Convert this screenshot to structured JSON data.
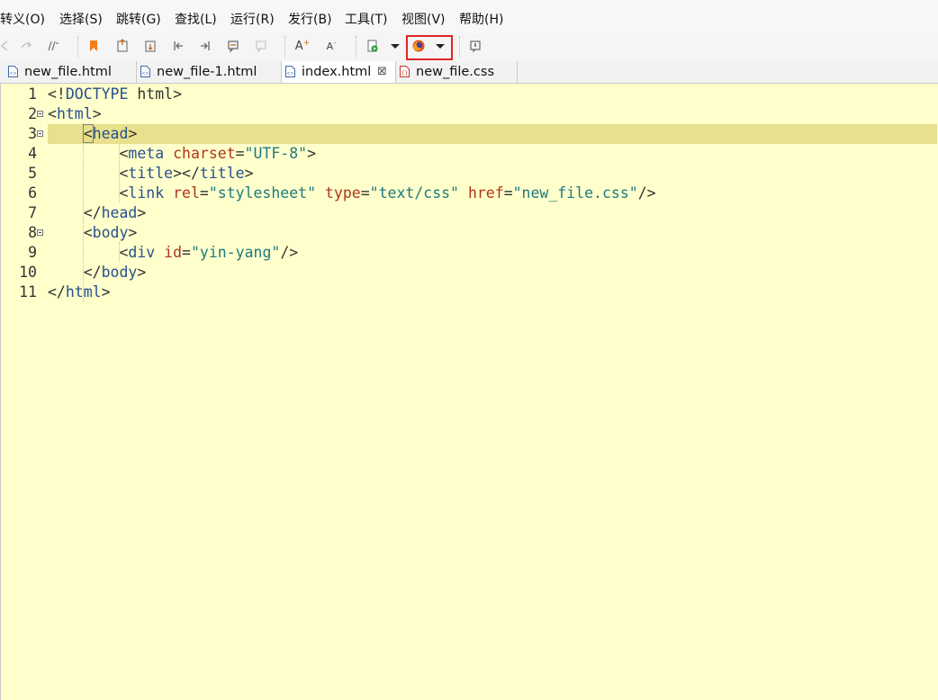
{
  "menu": {
    "items": [
      "转义(O)",
      "选择(S)",
      "跳转(G)",
      "查找(L)",
      "运行(R)",
      "发行(B)",
      "工具(T)",
      "视图(V)",
      "帮助(H)"
    ]
  },
  "toolbar": {
    "icons": [
      "back-icon",
      "forward-icon",
      "format-icon",
      "bookmark-icon",
      "bookmark-prev-icon",
      "bookmark-next-icon",
      "goto-start-icon",
      "goto-end-icon",
      "comment-icon",
      "uncomment-icon",
      "font-increase-icon",
      "font-decrease-icon",
      "run-icon",
      "run-dropdown-icon",
      "firefox-icon",
      "browser-dropdown-icon",
      "info-icon"
    ],
    "highlight_color": "#e02424",
    "font_increase": "A",
    "font_decrease": "A"
  },
  "tabs": [
    {
      "label": "new_file.html",
      "type": "html",
      "active": false
    },
    {
      "label": "new_file-1.html",
      "type": "html",
      "active": false
    },
    {
      "label": "index.html",
      "type": "html",
      "active": true,
      "close": "⊠"
    },
    {
      "label": "new_file.css",
      "type": "css",
      "active": false
    }
  ],
  "editor": {
    "highlight_line": 3,
    "lines": [
      {
        "num": "1",
        "tokens": [
          [
            "p",
            "<!"
          ],
          [
            "t",
            "DOCTYPE"
          ],
          [
            "p",
            " html>"
          ]
        ]
      },
      {
        "num": "2",
        "fold": true,
        "tokens": [
          [
            "p",
            "<"
          ],
          [
            "t",
            "html"
          ],
          [
            "p",
            ">"
          ]
        ]
      },
      {
        "num": "3",
        "fold": true,
        "tokens": [
          [
            "p",
            "    "
          ],
          [
            "p",
            "<"
          ],
          [
            "t",
            "head"
          ],
          [
            "p",
            ">"
          ]
        ]
      },
      {
        "num": "4",
        "tokens": [
          [
            "p",
            "        <"
          ],
          [
            "t",
            "meta "
          ],
          [
            "a",
            "charset"
          ],
          [
            "p",
            "="
          ],
          [
            "v",
            "\"UTF-8\""
          ],
          [
            "p",
            ">"
          ]
        ]
      },
      {
        "num": "5",
        "tokens": [
          [
            "p",
            "        <"
          ],
          [
            "t",
            "title"
          ],
          [
            "p",
            "></"
          ],
          [
            "t",
            "title"
          ],
          [
            "p",
            ">"
          ]
        ]
      },
      {
        "num": "6",
        "tokens": [
          [
            "p",
            "        <"
          ],
          [
            "t",
            "link "
          ],
          [
            "a",
            "rel"
          ],
          [
            "p",
            "="
          ],
          [
            "v",
            "\"stylesheet\" "
          ],
          [
            "a",
            "type"
          ],
          [
            "p",
            "="
          ],
          [
            "v",
            "\"text/css\" "
          ],
          [
            "a",
            "href"
          ],
          [
            "p",
            "="
          ],
          [
            "v",
            "\"new_file.css\""
          ],
          [
            "p",
            "/>"
          ]
        ]
      },
      {
        "num": "7",
        "tokens": [
          [
            "p",
            "    </"
          ],
          [
            "t",
            "head"
          ],
          [
            "p",
            ">"
          ]
        ]
      },
      {
        "num": "8",
        "fold": true,
        "tokens": [
          [
            "p",
            "    <"
          ],
          [
            "t",
            "body"
          ],
          [
            "p",
            ">"
          ]
        ]
      },
      {
        "num": "9",
        "tokens": [
          [
            "p",
            "        <"
          ],
          [
            "t",
            "div "
          ],
          [
            "a",
            "id"
          ],
          [
            "p",
            "="
          ],
          [
            "v",
            "\"yin-yang\""
          ],
          [
            "p",
            "/>"
          ]
        ]
      },
      {
        "num": "10",
        "tokens": [
          [
            "p",
            "    </"
          ],
          [
            "t",
            "body"
          ],
          [
            "p",
            ">"
          ]
        ]
      },
      {
        "num": "11",
        "tokens": [
          [
            "p",
            "</"
          ],
          [
            "t",
            "html"
          ],
          [
            "p",
            ">"
          ]
        ]
      }
    ]
  }
}
